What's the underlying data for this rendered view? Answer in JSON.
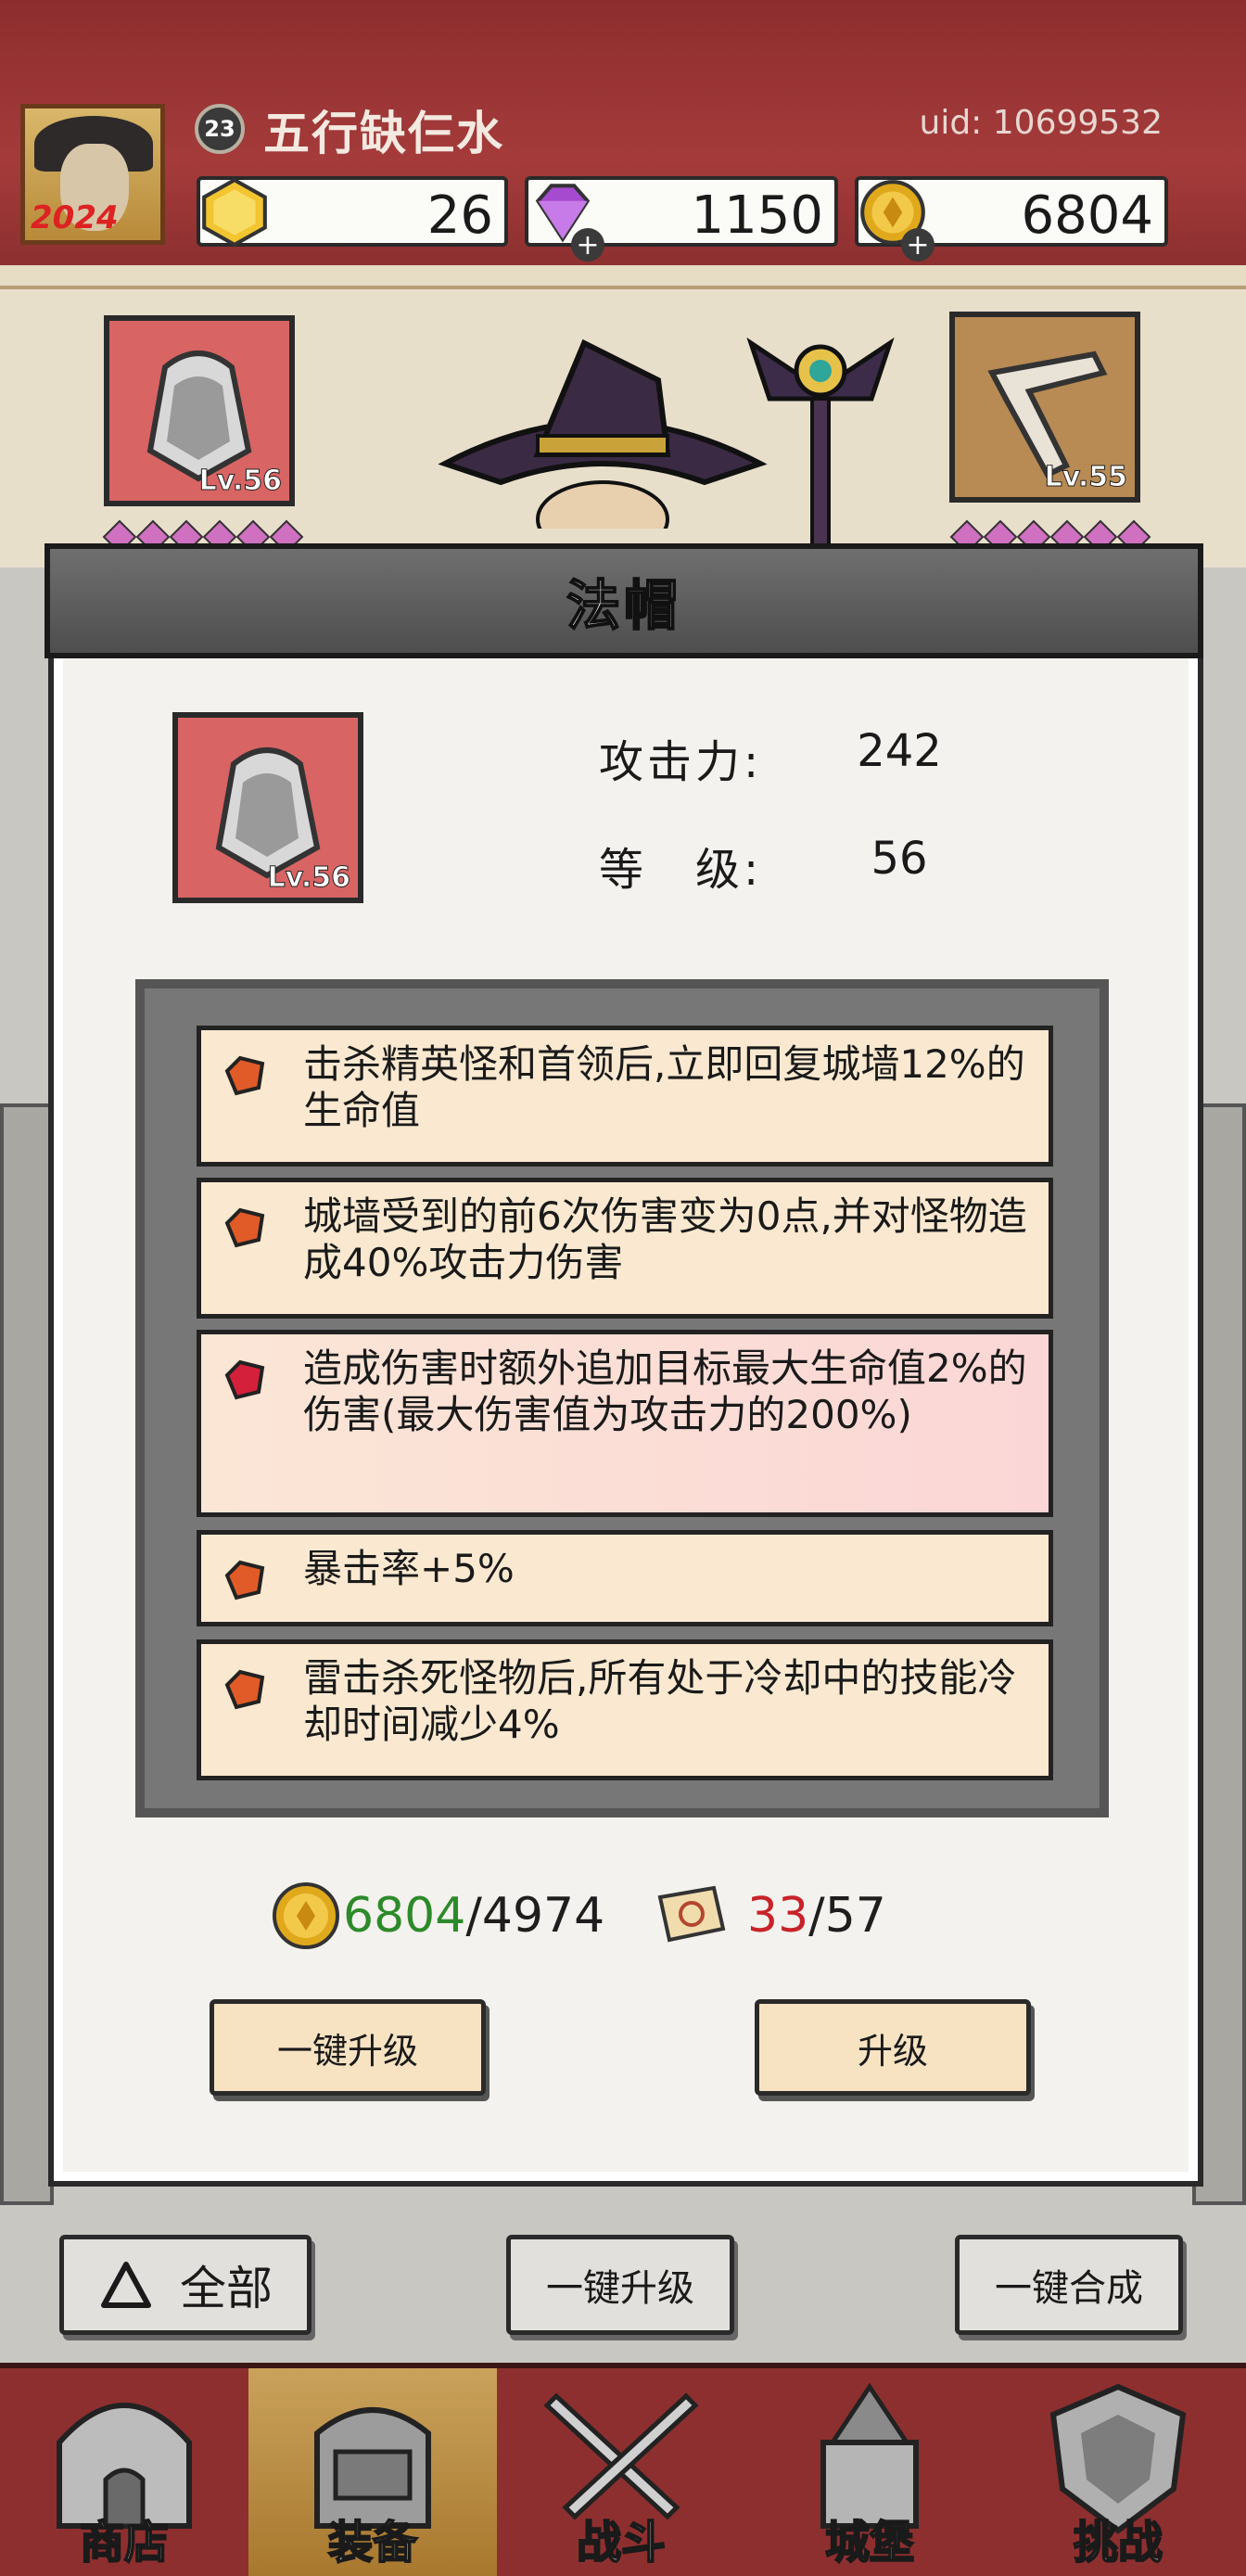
{
  "header": {
    "player_level": "23",
    "player_name": "五行缺仨水",
    "uid": "uid: 10699532",
    "avatar_year": "2024",
    "resources": [
      {
        "icon": "gem-yellow-icon",
        "value": "26"
      },
      {
        "icon": "diamond-purple-icon",
        "value": "1150"
      },
      {
        "icon": "gold-coin-icon",
        "value": "6804"
      }
    ]
  },
  "hero_slots": {
    "left_slot_level": "Lv.56",
    "right_slot_level": "Lv.55"
  },
  "modal": {
    "title": "法帽",
    "item_level": "Lv.56",
    "attack_label": "攻击力:",
    "attack_value": "242",
    "level_label": "等　级:",
    "level_value": "56",
    "skills": [
      {
        "text": "击杀精英怪和首领后,立即回复城墙12%的生命值",
        "gem": "orange"
      },
      {
        "text": "城墙受到的前6次伤害变为0点,并对怪物造成40%攻击力伤害",
        "gem": "orange"
      },
      {
        "text": "造成伤害时额外追加目标最大生命值2%的伤害(最大伤害值为攻击力的200%)",
        "gem": "red"
      },
      {
        "text": "暴击率+5%",
        "gem": "orange"
      },
      {
        "text": "雷击杀死怪物后,所有处于冷却中的技能冷却时间减少4%",
        "gem": "orange"
      }
    ],
    "gold_have": "6804",
    "gold_need": "/4974",
    "scroll_have": "33",
    "scroll_need": "/57",
    "btn_one_key_upgrade": "一键升级",
    "btn_upgrade": "升级"
  },
  "bottom_actions": {
    "filter_label": "全部",
    "one_key_upgrade": "一键升级",
    "one_key_merge": "一键合成"
  },
  "nav": [
    {
      "label": "商店",
      "icon": "shop-icon",
      "active": false
    },
    {
      "label": "装备",
      "icon": "backpack-icon",
      "active": true
    },
    {
      "label": "战斗",
      "icon": "crossed-swords-icon",
      "active": false
    },
    {
      "label": "城堡",
      "icon": "castle-icon",
      "active": false
    },
    {
      "label": "挑战",
      "icon": "shield-icon",
      "active": false
    }
  ],
  "colors": {
    "header_red": "#a53b3b",
    "accent_green": "#2d8a2a",
    "accent_red": "#c8232a",
    "button_cream": "#f7e3c2"
  }
}
